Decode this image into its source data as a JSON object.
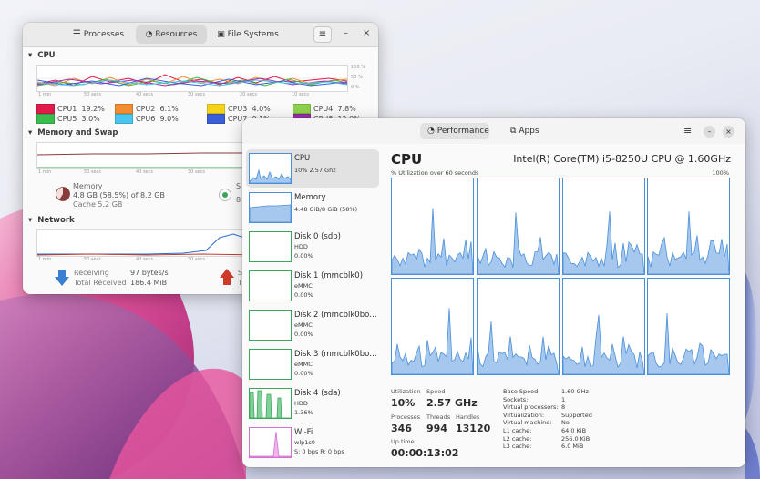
{
  "sysmon": {
    "tabs": [
      "Processes",
      "Resources",
      "File Systems"
    ],
    "cpu": {
      "section": "CPU",
      "axis": [
        "100 %",
        "50 %",
        "0 %"
      ],
      "time": [
        "1 min",
        "50 secs",
        "40 secs",
        "30 secs",
        "20 secs",
        "10 secs"
      ],
      "legend": [
        {
          "name": "CPU1",
          "value": "19.2%",
          "color": "#e01b4c"
        },
        {
          "name": "CPU2",
          "value": "6.1%",
          "color": "#f38c2f"
        },
        {
          "name": "CPU3",
          "value": "4.0%",
          "color": "#f5d31c"
        },
        {
          "name": "CPU4",
          "value": "7.8%",
          "color": "#8fd14b"
        },
        {
          "name": "CPU5",
          "value": "3.0%",
          "color": "#3bbc4e"
        },
        {
          "name": "CPU6",
          "value": "9.0%",
          "color": "#4ac6ee"
        },
        {
          "name": "CPU7",
          "value": "9.1%",
          "color": "#3a5dd8"
        },
        {
          "name": "CPU8",
          "value": "12.0%",
          "color": "#9a2fb0"
        }
      ]
    },
    "memory": {
      "section": "Memory and Swap",
      "time": [
        "1 min",
        "50 secs",
        "40 secs",
        "30 secs"
      ],
      "label": "Memory",
      "value": "4.8 GB (58.5%) of 8.2 GB",
      "cache": "Cache 5.2 GB",
      "swap_partial": "S",
      "swap_partial2": "8"
    },
    "network": {
      "section": "Network",
      "time": [
        "1 min",
        "50 secs",
        "40 secs",
        "30 secs"
      ],
      "receiving_label": "Receiving",
      "receiving_value": "97 bytes/s",
      "total_label": "Total Received",
      "total_value": "186.4 MiB",
      "send_partial": "S",
      "send_partial2": "T"
    }
  },
  "perf": {
    "tabs": [
      "Performance",
      "Apps"
    ],
    "sidebar": [
      {
        "name": "CPU",
        "lines": [
          "10% 2.57 Ghz"
        ]
      },
      {
        "name": "Memory",
        "lines": [
          "4.48 GiB/8 GiB (58%)"
        ]
      },
      {
        "name": "Disk 0 (sdb)",
        "lines": [
          "HDD",
          "0.00%"
        ]
      },
      {
        "name": "Disk 1 (mmcblk0)",
        "lines": [
          "eMMC",
          "0.00%"
        ]
      },
      {
        "name": "Disk 2 (mmcblk0bo…",
        "lines": [
          "eMMC",
          "0.00%"
        ]
      },
      {
        "name": "Disk 3 (mmcblk0bo…",
        "lines": [
          "eMMC",
          "0.00%"
        ]
      },
      {
        "name": "Disk 4 (sda)",
        "lines": [
          "HDD",
          "1.36%"
        ]
      },
      {
        "name": "Wi-Fi",
        "lines": [
          "wlp1s0",
          "S: 0 bps R: 0 bps"
        ]
      }
    ],
    "main": {
      "title": "CPU",
      "model": "Intel(R) Core(TM) i5-8250U CPU @ 1.60GHz",
      "subtitle": "% Utilization over 60 seconds",
      "max": "100%",
      "stats": {
        "utilization_label": "Utilization",
        "utilization": "10%",
        "speed_label": "Speed",
        "speed": "2.57 GHz",
        "processes_label": "Processes",
        "processes": "346",
        "threads_label": "Threads",
        "threads": "994",
        "handles_label": "Handles",
        "handles": "13120",
        "uptime_label": "Up time",
        "uptime": "00:00:13:02"
      },
      "details": [
        {
          "k": "Base Speed:",
          "v": "1.60 GHz"
        },
        {
          "k": "Sockets:",
          "v": "1"
        },
        {
          "k": "Virtual processors:",
          "v": "8"
        },
        {
          "k": "Virtualization:",
          "v": "Supported"
        },
        {
          "k": "Virtual machine:",
          "v": "No"
        },
        {
          "k": "L1 cache:",
          "v": "64.0 KiB"
        },
        {
          "k": "L2 cache:",
          "v": "256.0 KiB"
        },
        {
          "k": "L3 cache:",
          "v": "6.0 MiB"
        }
      ]
    }
  }
}
